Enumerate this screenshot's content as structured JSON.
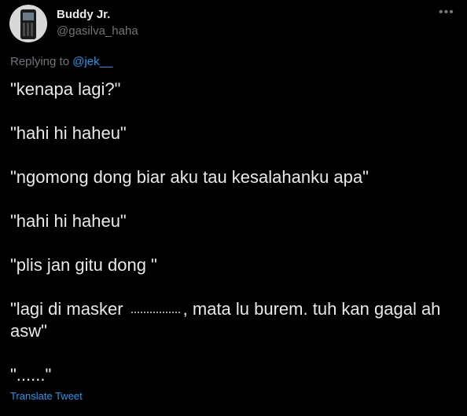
{
  "author": {
    "display_name": "Buddy Jr.",
    "handle": "@gasilva_haha",
    "avatar_icon": "phone-avatar-icon"
  },
  "more_icon": "more-options-icon",
  "reply": {
    "prefix": "Replying to",
    "mention": "@jek__"
  },
  "tweet": {
    "lines": [
      "\"kenapa lagi?\"",
      "\"hahi hi haheu\"",
      "\"ngomong dong biar aku tau kesalahanku apa\"",
      "\"hahi hi haheu\"",
      "\"plis jan gitu dong \"",
      "\"lagi di masker",
      ", mata lu burem. tuh kan gagal ah asw\"",
      "\"......\""
    ]
  },
  "translate_label": "Translate Tweet",
  "colors": {
    "background": "#000000",
    "text": "#e7e9ea",
    "muted": "#71767b",
    "accent": "#1d9bf0"
  }
}
